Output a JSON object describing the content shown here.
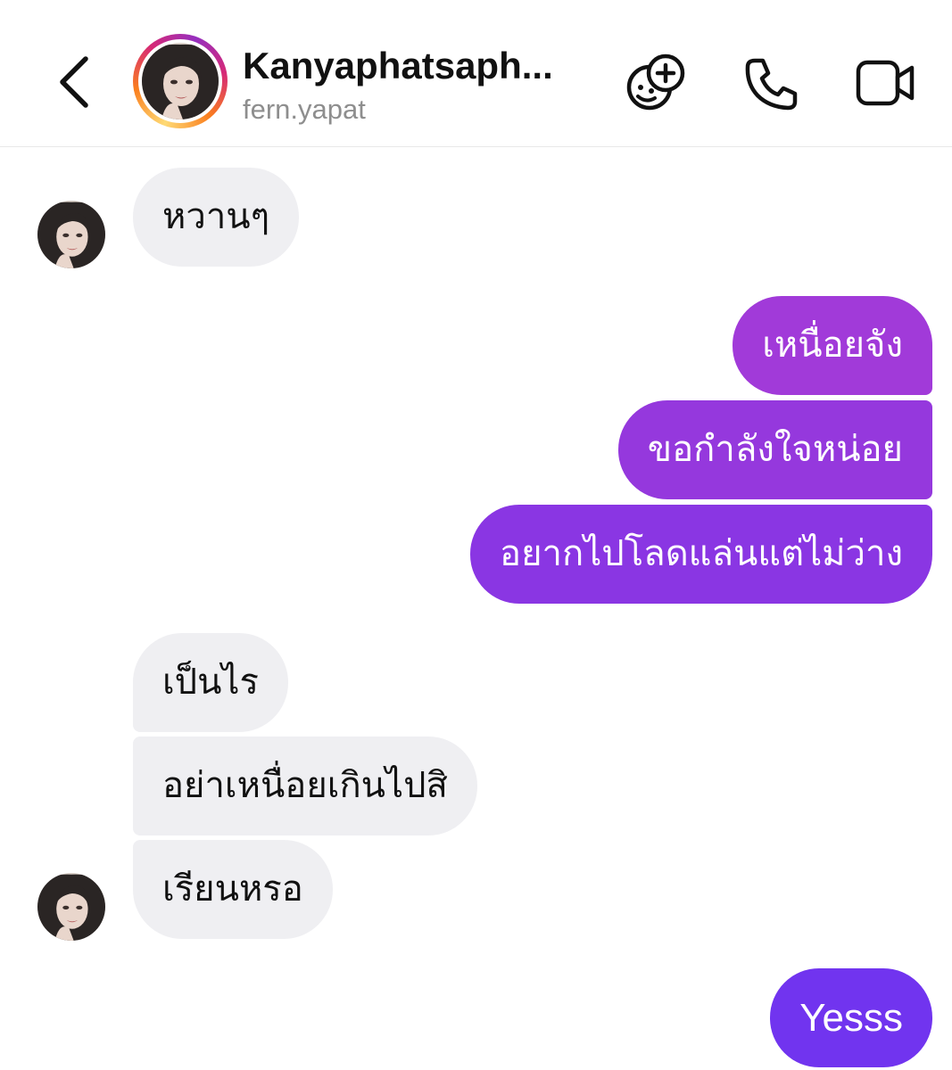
{
  "header": {
    "title": "Kanyaphatsaph...",
    "username": "fern.yapat",
    "icons": {
      "back": "chevron-left-icon",
      "effects": "sticker-plus-icon",
      "call": "phone-icon",
      "video": "video-camera-icon"
    },
    "story_ring": true
  },
  "messages": [
    {
      "id": "m1",
      "from": "them",
      "text": "หวานๆ"
    },
    {
      "id": "m2",
      "from": "me",
      "text": "เหนื่อยจัง"
    },
    {
      "id": "m3",
      "from": "me",
      "text": "ขอกำลังใจหน่อย"
    },
    {
      "id": "m4",
      "from": "me",
      "text": "อยากไปโลดแล่นแต่ไม่ว่าง"
    },
    {
      "id": "m5",
      "from": "them",
      "text": "เป็นไร"
    },
    {
      "id": "m6",
      "from": "them",
      "text": "อย่าเหนื่อยเกินไปสิ"
    },
    {
      "id": "m7",
      "from": "them",
      "text": "เรียนหรอ"
    },
    {
      "id": "m8",
      "from": "me",
      "text": "Yesss"
    }
  ],
  "colors": {
    "incoming_bubble": "#efeff2",
    "outgoing_gradient_top": "#a33ad8",
    "outgoing_gradient_bottom": "#7133f0",
    "subtitle": "#8e8e8e",
    "divider": "#e8e8e8"
  }
}
